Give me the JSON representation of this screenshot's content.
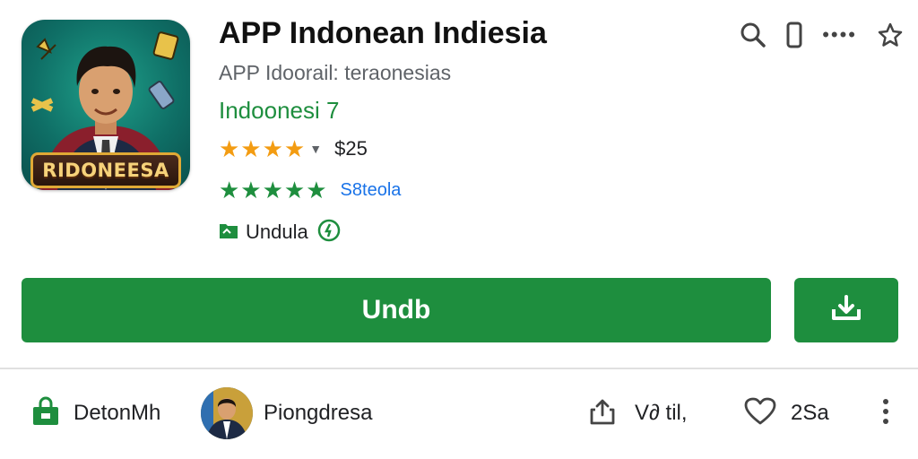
{
  "app": {
    "title": "APP Indonean Indiesia",
    "subtitle": "APP Idoorail: teraonesias",
    "developer": "Indoonesi 7",
    "icon_banner": "RIDONEESA",
    "icon": "app-icon-character"
  },
  "rating": {
    "stars_display": "★★★★",
    "price": "$25",
    "stars2_display": "★★★★★",
    "reviews_link": "S8teola"
  },
  "badge": {
    "label": "Undula"
  },
  "toolbar": {
    "icons": [
      "search-icon",
      "phone-icon",
      "more-dots-icon",
      "star-outline-icon"
    ],
    "dots": "••••"
  },
  "actions": {
    "install_label": "Undb",
    "download_icon": "download-icon"
  },
  "bottom": {
    "store_label": "DetonMh",
    "developer_name": "Piongdresa",
    "share_label": "V∂ til,",
    "likes_count": "2Sa"
  },
  "colors": {
    "accent": "#1e8e3e",
    "star_orange": "#f39c12",
    "link_blue": "#1a73e8"
  }
}
